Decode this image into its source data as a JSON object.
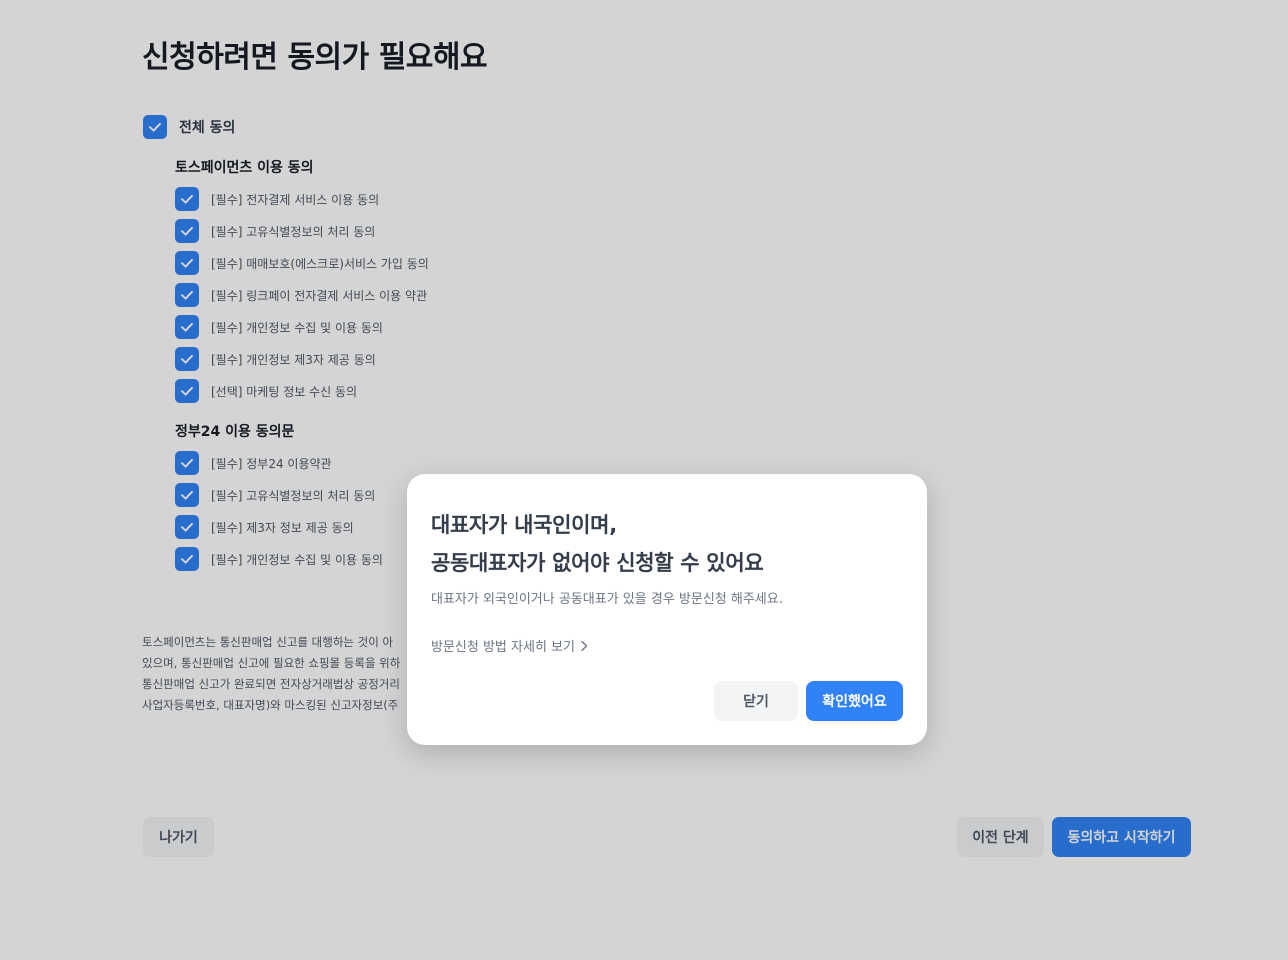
{
  "page": {
    "title": "신청하려면 동의가 필요해요",
    "agree_all": {
      "label": "전체 동의",
      "checked": true
    },
    "sections": [
      {
        "title": "토스페이먼츠 이용 동의",
        "items": [
          {
            "label": "[필수] 전자결제 서비스 이용 동의",
            "checked": true
          },
          {
            "label": "[필수] 고유식별정보의 처리 동의",
            "checked": true
          },
          {
            "label": "[필수] 매매보호(에스크로)서비스 가입 동의",
            "checked": true
          },
          {
            "label": "[필수] 링크페이 전자결제 서비스 이용 약관",
            "checked": true
          },
          {
            "label": "[필수] 개인정보 수집 및 이용 동의",
            "checked": true
          },
          {
            "label": "[필수] 개인정보 제3자 제공 동의",
            "checked": true
          },
          {
            "label": "[선택] 마케팅 정보 수신 동의",
            "checked": true
          }
        ]
      },
      {
        "title": "정부24 이용 동의문",
        "items": [
          {
            "label": "[필수] 정부24 이용약관",
            "checked": true
          },
          {
            "label": "[필수] 고유식별정보의 처리 동의",
            "checked": true
          },
          {
            "label": "[필수] 제3자 정보 제공 동의",
            "checked": true
          },
          {
            "label": "[필수] 개인정보 수집 및 이용 동의",
            "checked": true
          }
        ]
      }
    ],
    "notice_lines": [
      "토스페이먼츠는 통신판매업 신고를 대행하는 것이 아",
      "있으며, 통신판매업 신고에 필요한 쇼핑몰 등록을 위하",
      "통신판매업 신고가 완료되면 전자상거래법상 공정거리",
      "사업자등록번호, 대표자명)와 마스킹된 신고자정보(주"
    ],
    "buttons": {
      "exit": "나가기",
      "prev": "이전 단계",
      "agree_start": "동의하고 시작하기"
    }
  },
  "dialog": {
    "title_line1": "대표자가 내국인이며,",
    "title_line2": "공동대표자가 없어야 신청할 수 있어요",
    "description": "대표자가 외국인이거나 공동대표가 있을 경우 방문신청 해주세요.",
    "link_label": "방문신청 방법 자세히 보기",
    "close_label": "닫기",
    "confirm_label": "확인했어요"
  },
  "colors": {
    "accent": "#3182f6",
    "gray_button": "#f2f4f6",
    "overlay": "rgba(0,0,0,0.17)"
  }
}
